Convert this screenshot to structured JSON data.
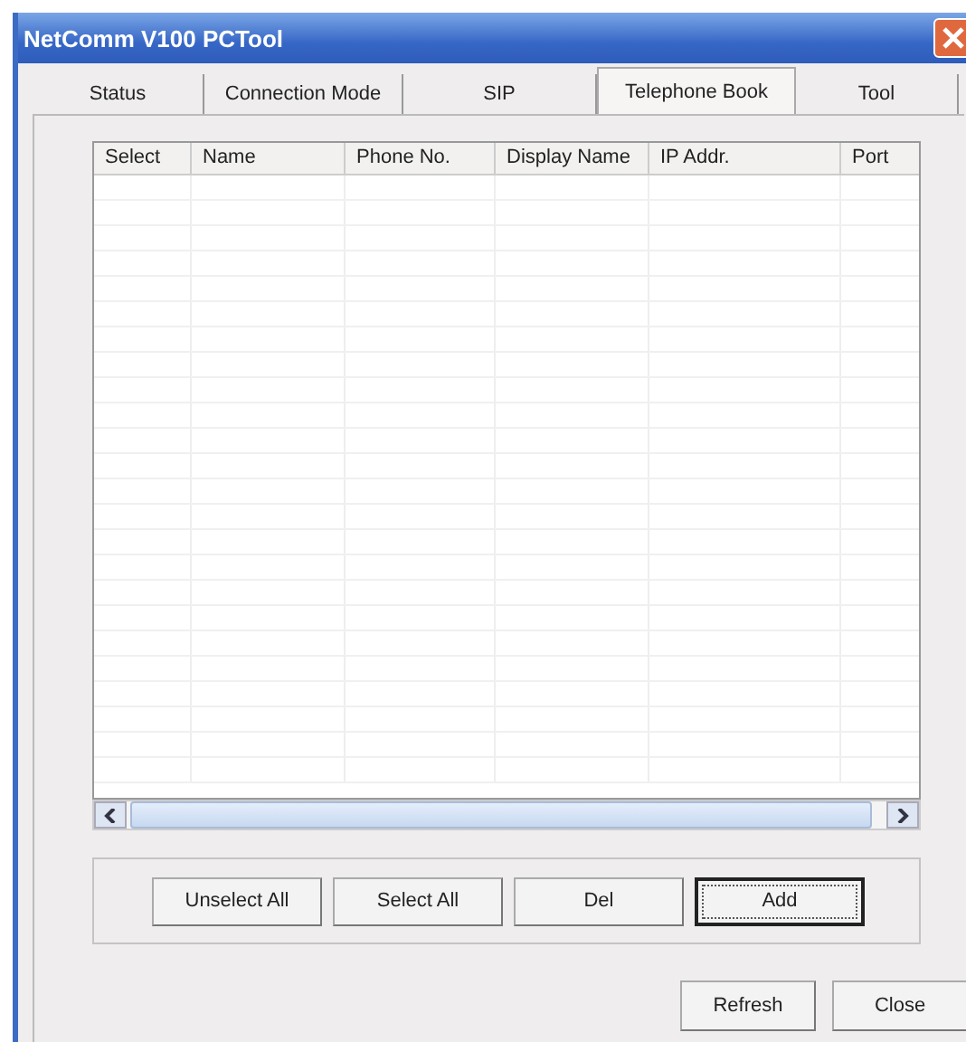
{
  "window": {
    "title": "NetComm V100 PCTool"
  },
  "tabs": [
    {
      "label": "Status",
      "selected": false
    },
    {
      "label": "Connection Mode",
      "selected": false
    },
    {
      "label": "SIP",
      "selected": false
    },
    {
      "label": "Telephone Book",
      "selected": true
    },
    {
      "label": "Tool",
      "selected": false
    }
  ],
  "table": {
    "columns": [
      "Select",
      "Name",
      "Phone No.",
      "Display Name",
      "IP Addr.",
      "Port"
    ]
  },
  "actions": [
    {
      "label": "Unselect All",
      "focused": false
    },
    {
      "label": "Select All",
      "focused": false
    },
    {
      "label": "Del",
      "focused": false
    },
    {
      "label": "Add",
      "focused": true
    }
  ],
  "footer_buttons": [
    "Refresh",
    "Close"
  ]
}
